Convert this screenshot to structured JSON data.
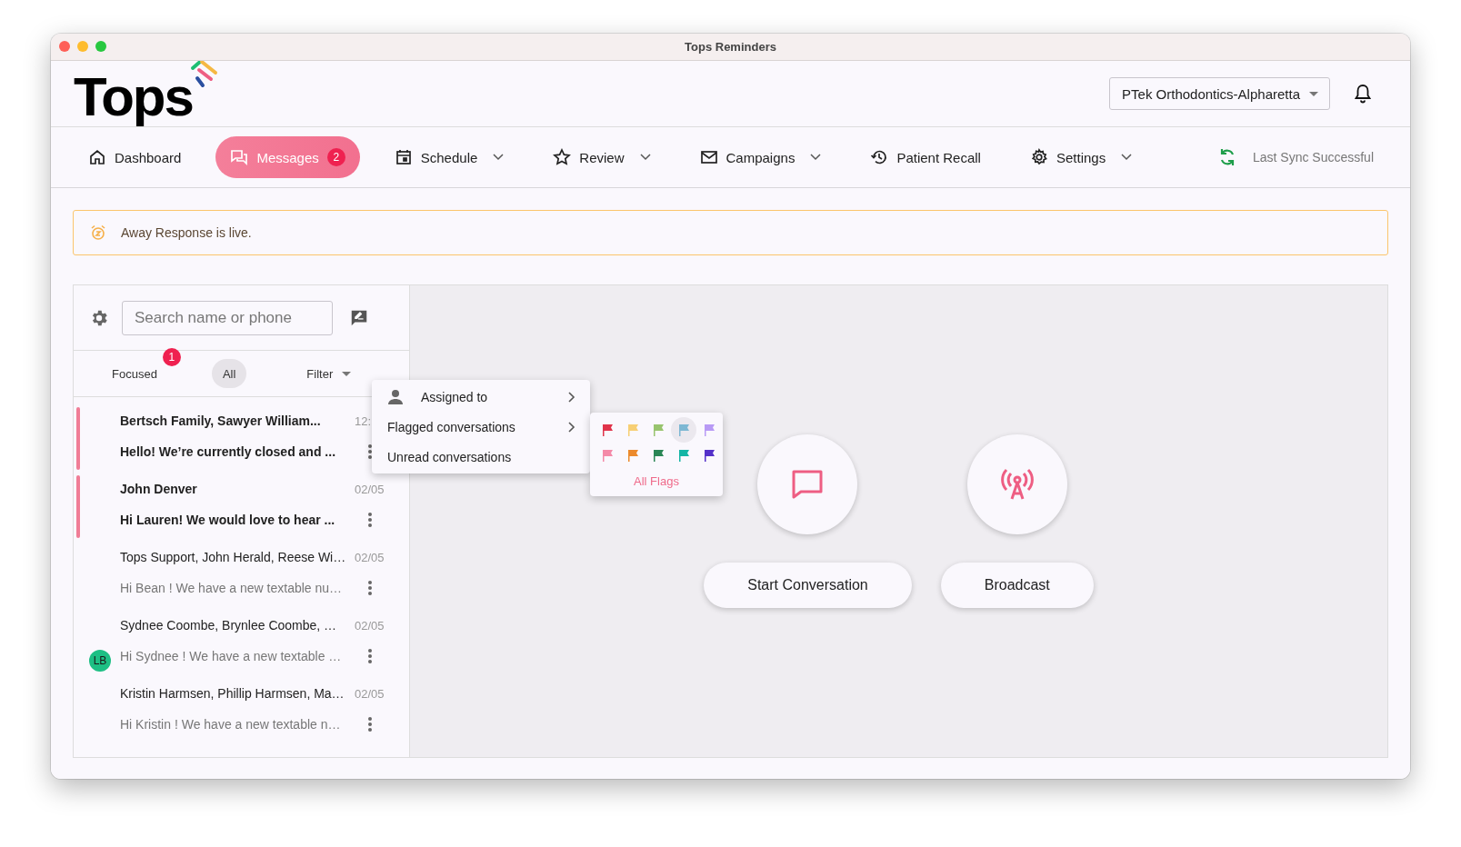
{
  "window": {
    "title": "Tops Reminders"
  },
  "header": {
    "logo": "Tops",
    "location": "PTek Orthodontics-Alpharetta"
  },
  "nav": [
    {
      "label": "Dashboard",
      "kind": "home",
      "dropdown": false,
      "selected": false
    },
    {
      "label": "Messages",
      "kind": "chat",
      "dropdown": false,
      "selected": true,
      "badge": "2"
    },
    {
      "label": "Schedule",
      "kind": "calendar",
      "dropdown": true,
      "selected": false
    },
    {
      "label": "Review",
      "kind": "star",
      "dropdown": true,
      "selected": false
    },
    {
      "label": "Campaigns",
      "kind": "mail",
      "dropdown": true,
      "selected": false
    },
    {
      "label": "Patient Recall",
      "kind": "history",
      "dropdown": false,
      "selected": false
    },
    {
      "label": "Settings",
      "kind": "gear",
      "dropdown": true,
      "selected": false
    }
  ],
  "sync_status": "Last Sync Successful",
  "banner": {
    "text": "Away Response is live."
  },
  "search": {
    "placeholder": "Search name or phone"
  },
  "tabs": [
    {
      "label": "Focused",
      "selected": false,
      "badge": "1"
    },
    {
      "label": "All",
      "selected": true
    }
  ],
  "filter": {
    "label": "Filter"
  },
  "conversations": [
    {
      "name": "Bertsch Family, Sawyer William...",
      "time": "12:",
      "preview": "Hello! We’re currently closed and ...",
      "unread": true
    },
    {
      "name": "John Denver",
      "time": "02/05",
      "preview": "Hi Lauren! We would love to hear ...",
      "unread": true
    },
    {
      "name": "Tops Support, John Herald, Reese Wi…",
      "time": "02/05",
      "preview": "Hi Bean ! We have a new textable nu…",
      "unread": false
    },
    {
      "name": "Sydnee Coombe, Brynlee Coombe, …",
      "time": "02/05",
      "preview": "Hi Sydnee ! We have a new textable …",
      "unread": false,
      "avatar": "LB",
      "color": "#1dbf84"
    },
    {
      "name": "Kristin Harmsen, Phillip Harmsen, Ma…",
      "time": "02/05",
      "preview": "Hi Kristin ! We have a new textable n…",
      "unread": false
    }
  ],
  "filter_menu": [
    {
      "label": "Assigned to",
      "kind": "person",
      "submenu": true
    },
    {
      "label": "Flagged conversations",
      "kind": "plain",
      "submenu": true
    },
    {
      "label": "Unread conversations",
      "kind": "plain",
      "submenu": false
    }
  ],
  "flags": [
    {
      "color": "#e0334a",
      "selected": false
    },
    {
      "color": "#f7cf74",
      "selected": false
    },
    {
      "color": "#98c46e",
      "selected": false
    },
    {
      "color": "#7db7d3",
      "selected": true
    },
    {
      "color": "#b89af5",
      "selected": false
    },
    {
      "color": "#f48aa8",
      "selected": false
    },
    {
      "color": "#ec8a2c",
      "selected": false
    },
    {
      "color": "#2a8655",
      "selected": false
    },
    {
      "color": "#14b5a5",
      "selected": false
    },
    {
      "color": "#5431c9",
      "selected": false
    }
  ],
  "all_flags": "All Flags",
  "actions": [
    {
      "label": "Start Conversation",
      "kind": "chat"
    },
    {
      "label": "Broadcast",
      "kind": "broadcast"
    }
  ]
}
